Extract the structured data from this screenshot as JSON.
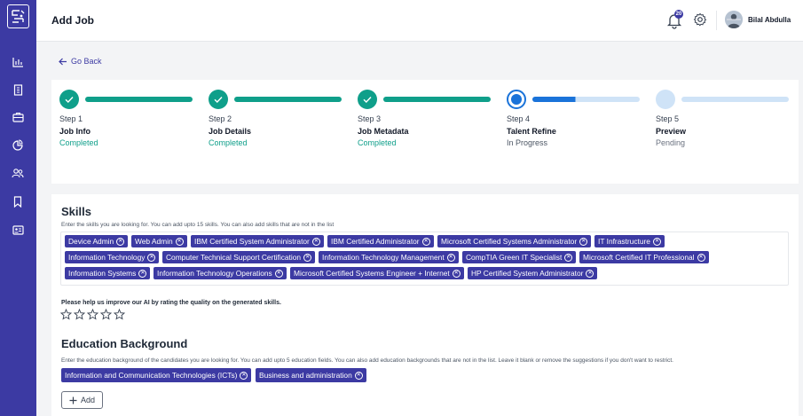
{
  "header": {
    "title": "Add Job",
    "notification_count": "20",
    "user_name": "Bilal Abdulla"
  },
  "nav": {
    "go_back": "Go Back"
  },
  "steps": [
    {
      "num": "Step 1",
      "title": "Job Info",
      "status": "Completed",
      "state": "completed",
      "progress": 1.0
    },
    {
      "num": "Step 2",
      "title": "Job Details",
      "status": "Completed",
      "state": "completed",
      "progress": 1.0
    },
    {
      "num": "Step 3",
      "title": "Job Metadata",
      "status": "Completed",
      "state": "completed",
      "progress": 1.0
    },
    {
      "num": "Step 4",
      "title": "Talent Refine",
      "status": "In Progress",
      "state": "active",
      "progress": 0.4
    },
    {
      "num": "Step 5",
      "title": "Preview",
      "status": "Pending",
      "state": "pending",
      "progress": 0.0
    }
  ],
  "skills": {
    "title": "Skills",
    "description": "Enter the skills you are looking for. You can add upto 15 skills. You can also add skills that are not in the list",
    "chips": [
      [
        "Device Admin",
        "Web Admin",
        "IBM Certified System Administrator",
        "IBM Certified Administrator",
        "Microsoft Certified Systems Administrator",
        "IT Infrastructure"
      ],
      [
        "Information Technology",
        "Computer Technical Support Certification",
        "Information Technology Management",
        "CompTIA Green IT Specialist",
        "Microsoft Certified IT Professional"
      ],
      [
        "Information Systems",
        "Information Technology Operations",
        "Microsoft Certified Systems Engineer + Internet",
        "HP Certified System Administrator"
      ]
    ],
    "rating_prompt": "Please help us improve our AI by rating the quality on the generated skills.",
    "rating": 0,
    "rating_max": 5
  },
  "education": {
    "title": "Education Background",
    "description": "Enter the education background of the candidates you are looking for. You can add upto 5 education fields. You can also add education backgrounds that are not in the list. Leave it blank or remove the suggestions if you don't want to restrict.",
    "chips": [
      "Information and Communication Technologies (ICTs)",
      "Business and administration"
    ],
    "add_label": "Add"
  },
  "colors": {
    "sidebar": "#3c3aa3",
    "completed": "#0f9f8a",
    "active": "#1a73d9",
    "pending": "#cfe3f7",
    "chip": "#3c3aa3"
  }
}
